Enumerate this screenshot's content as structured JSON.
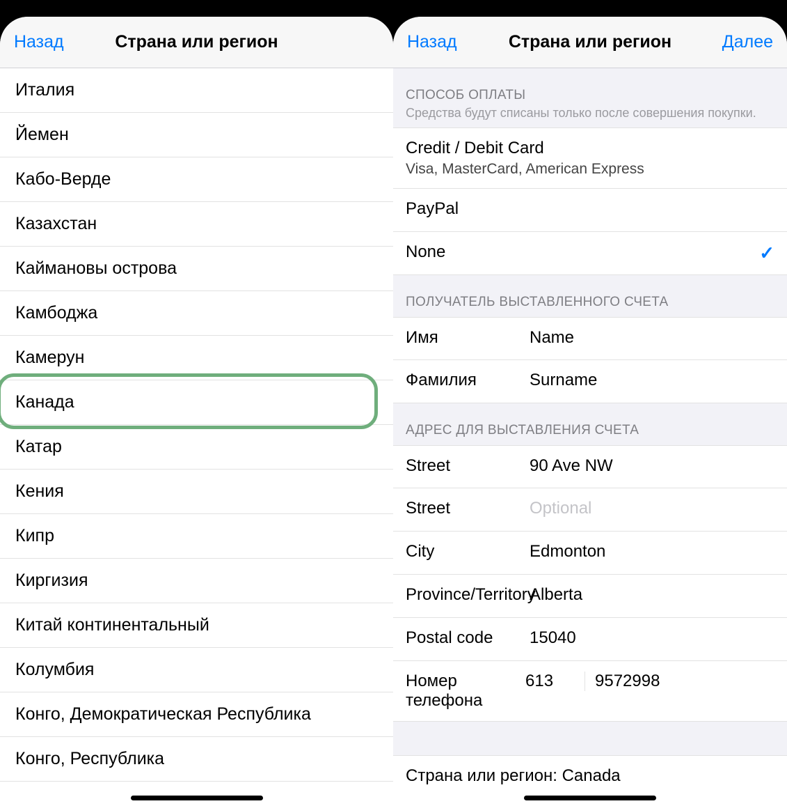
{
  "left": {
    "nav": {
      "back": "Назад",
      "title": "Страна или регион"
    },
    "countries": [
      "Италия",
      "Йемен",
      "Кабо-Верде",
      "Казахстан",
      "Каймановы острова",
      "Камбоджа",
      "Камерун",
      "Канада",
      "Катар",
      "Кения",
      "Кипр",
      "Киргизия",
      "Китай континентальный",
      "Колумбия",
      "Конго, Демократическая Республика",
      "Конго, Республика"
    ],
    "highlight_index": 7
  },
  "right": {
    "nav": {
      "back": "Назад",
      "title": "Страна или регион",
      "next": "Далее"
    },
    "payment": {
      "header": "СПОСОБ ОПЛАТЫ",
      "sub": "Средства будут списаны только после совершения покупки.",
      "options": [
        {
          "label": "Credit / Debit Card",
          "sub": "Visa, MasterCard, American Express",
          "checked": false
        },
        {
          "label": "PayPal",
          "checked": false
        },
        {
          "label": "None",
          "checked": true
        }
      ]
    },
    "billing_name": {
      "header": "ПОЛУЧАТЕЛЬ ВЫСТАВЛЕННОГО СЧЕТА",
      "fields": [
        {
          "label": "Имя",
          "value": "Name"
        },
        {
          "label": "Фамилия",
          "value": "Surname"
        }
      ]
    },
    "billing_address": {
      "header": "АДРЕС ДЛЯ ВЫСТАВЛЕНИЯ СЧЕТА",
      "fields": [
        {
          "label": "Street",
          "value": "90 Ave NW",
          "placeholder": false
        },
        {
          "label": "Street",
          "value": "Optional",
          "placeholder": true
        },
        {
          "label": "City",
          "value": "Edmonton",
          "placeholder": false
        },
        {
          "label": "Province/Territory",
          "value": "Alberta",
          "placeholder": false
        },
        {
          "label": "Postal code",
          "value": "15040",
          "placeholder": false
        }
      ],
      "phone": {
        "label": "Номер телефона",
        "code": "613",
        "number": "9572998"
      },
      "country_summary": "Страна или регион: Canada"
    }
  }
}
